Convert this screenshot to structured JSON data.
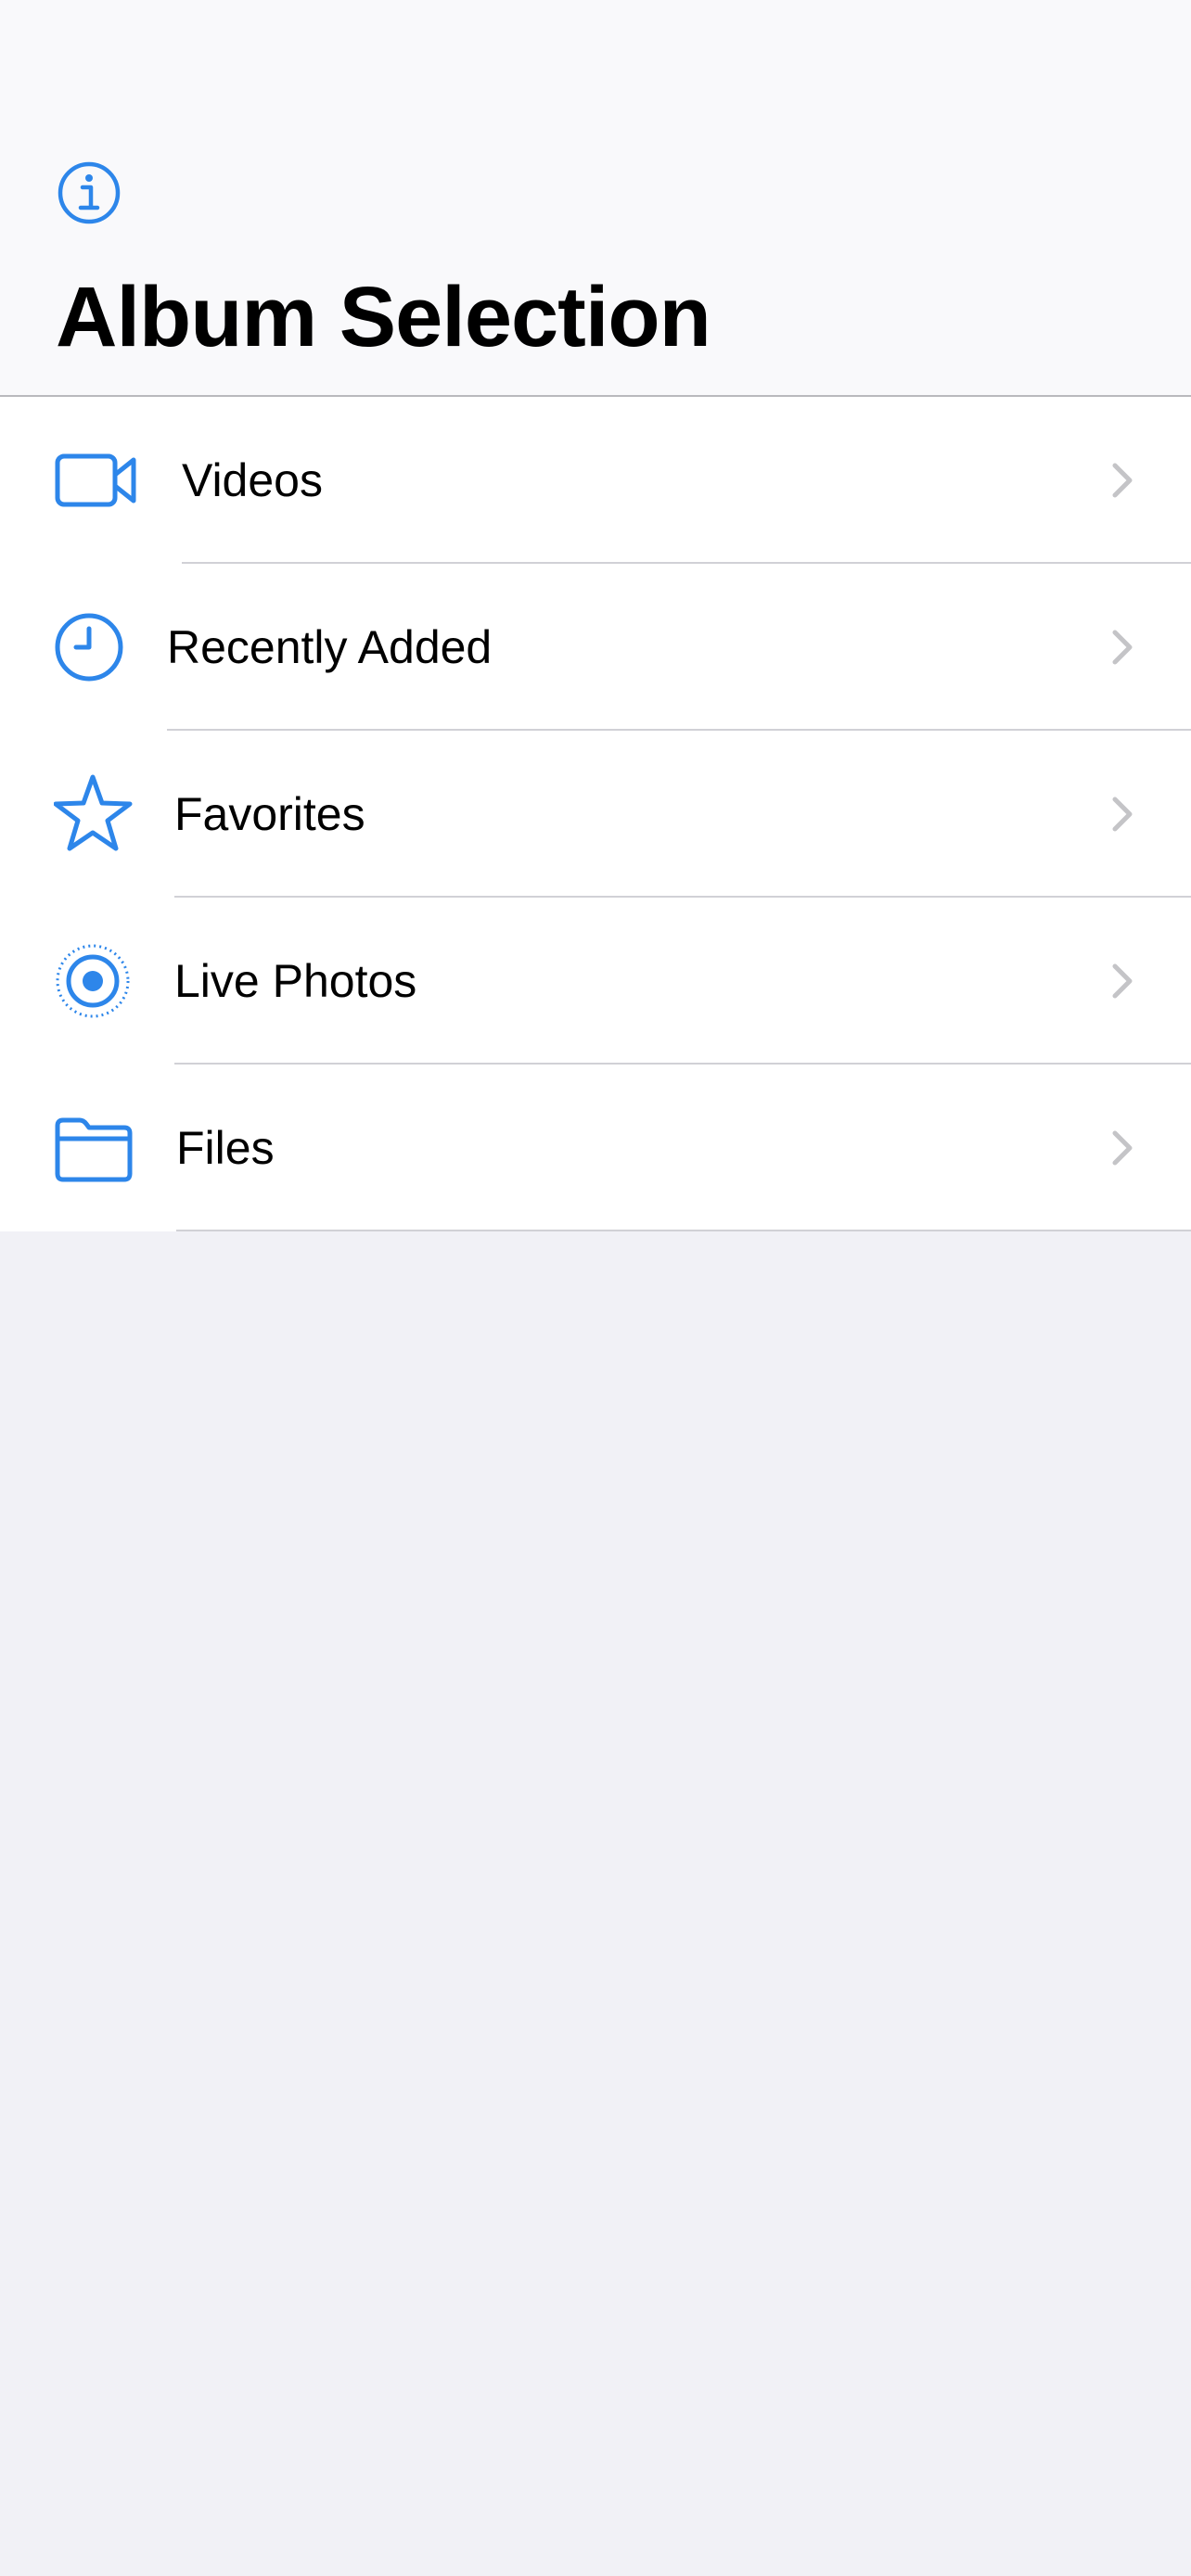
{
  "header": {
    "title": "Album Selection",
    "info_icon": "info-circle-icon"
  },
  "albums": [
    {
      "label": "Videos",
      "icon": "video-camera-icon"
    },
    {
      "label": "Recently Added",
      "icon": "clock-icon"
    },
    {
      "label": "Favorites",
      "icon": "star-icon"
    },
    {
      "label": "Live Photos",
      "icon": "live-photos-icon"
    },
    {
      "label": "Files",
      "icon": "folder-icon"
    }
  ],
  "colors": {
    "accent": "#2d86ea",
    "chevron": "#c4c4c7",
    "background": "#f1f1f6",
    "header_background": "#f9f9fb",
    "separator": "#d1d1d6",
    "text": "#000000"
  }
}
